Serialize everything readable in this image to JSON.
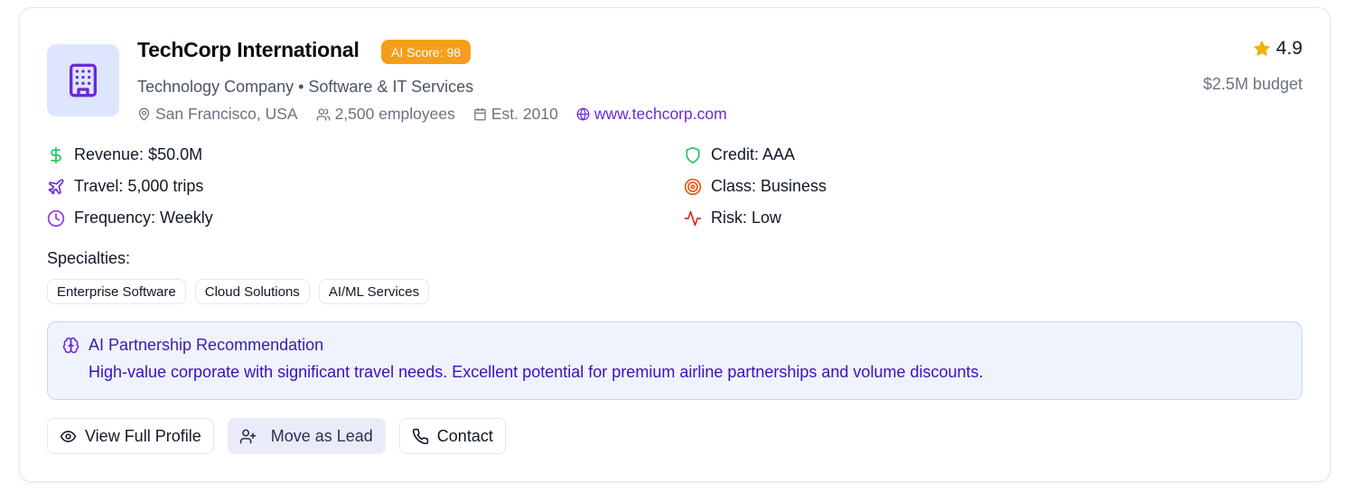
{
  "company": {
    "name": "TechCorp International",
    "ai_score_label": "AI Score: 98",
    "subtitle": "Technology Company • Software & IT Services",
    "location": "San Francisco, USA",
    "employees": "2,500 employees",
    "established": "Est. 2010",
    "website": "www.techcorp.com",
    "rating": "4.9",
    "budget": "$2.5M budget"
  },
  "stats": {
    "revenue": "Revenue: $50.0M",
    "travel": "Travel: 5,000 trips",
    "frequency": "Frequency: Weekly",
    "credit": "Credit: AAA",
    "class": "Class: Business",
    "risk": "Risk: Low"
  },
  "specialties": {
    "label": "Specialties:",
    "items": [
      "Enterprise Software",
      "Cloud Solutions",
      "AI/ML Services"
    ]
  },
  "recommendation": {
    "title": "AI Partnership Recommendation",
    "text": "High-value corporate with significant travel needs. Excellent potential for premium airline partnerships and volume discounts."
  },
  "actions": {
    "view_profile": "View Full Profile",
    "move_lead": "Move as Lead",
    "contact": "Contact"
  },
  "colors": {
    "badge": "#f59e1b",
    "accent_purple": "#6d28d9",
    "revenue_icon": "#22c55e",
    "travel_icon": "#6d28d9",
    "frequency_icon": "#9333ea",
    "credit_icon": "#22c55e",
    "class_icon": "#ea580c",
    "risk_icon": "#dc2626",
    "star": "#eab308"
  },
  "icons": {
    "logo": "building-icon",
    "location": "map-pin-icon",
    "employees": "users-icon",
    "established": "calendar-icon",
    "website": "globe-icon",
    "rating": "star-icon",
    "revenue": "dollar-icon",
    "travel": "plane-icon",
    "frequency": "clock-icon",
    "credit": "shield-icon",
    "class": "target-icon",
    "risk": "activity-icon",
    "recommendation": "brain-icon",
    "view_profile": "eye-icon",
    "move_lead": "user-plus-icon",
    "contact": "phone-icon"
  }
}
